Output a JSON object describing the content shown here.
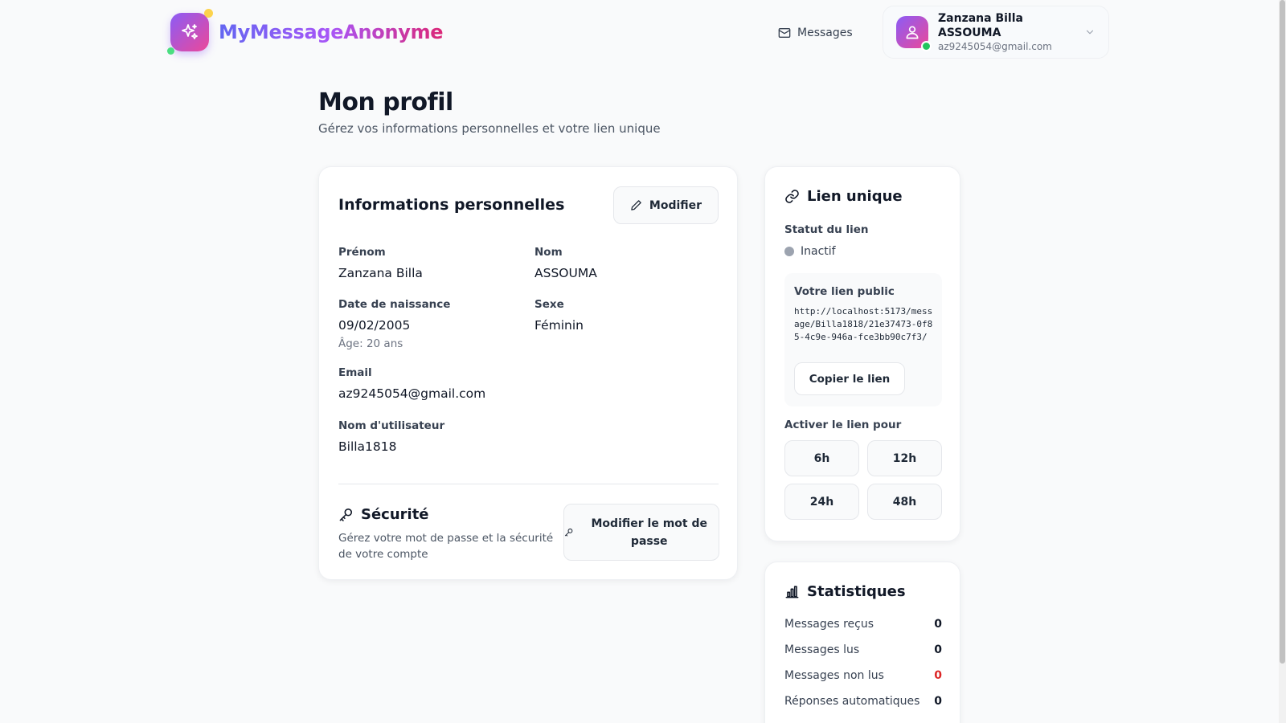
{
  "header": {
    "brand": "MyMessageAnonyme",
    "nav_messages": "Messages",
    "user": {
      "name": "Zanzana Billa ASSOUMA",
      "email": "az9245054@gmail.com"
    }
  },
  "page": {
    "title": "Mon profil",
    "subtitle": "Gérez vos informations personnelles et votre lien unique"
  },
  "personal_info": {
    "title": "Informations personnelles",
    "edit_button": "Modifier",
    "fields": {
      "first_name": {
        "label": "Prénom",
        "value": "Zanzana Billa"
      },
      "last_name": {
        "label": "Nom",
        "value": "ASSOUMA"
      },
      "birth_date": {
        "label": "Date de naissance",
        "value": "09/02/2005",
        "hint": "Âge: 20 ans"
      },
      "gender": {
        "label": "Sexe",
        "value": "Féminin"
      },
      "email": {
        "label": "Email",
        "value": "az9245054@gmail.com"
      },
      "username": {
        "label": "Nom d'utilisateur",
        "value": "Billa1818"
      }
    },
    "security": {
      "title": "Sécurité",
      "description": "Gérez votre mot de passe et la sécurité de votre compte",
      "button": "Modifier le mot de passe"
    }
  },
  "unique_link": {
    "title": "Lien unique",
    "status_label": "Statut du lien",
    "status": "Inactif",
    "public_link_label": "Votre lien public",
    "url": "http://localhost:5173/message/Billa1818/21e37473-0f85-4c9e-946a-fce3bb90c7f3/",
    "copy_button": "Copier le lien",
    "activate_label": "Activer le lien pour",
    "durations": [
      "6h",
      "12h",
      "24h",
      "48h"
    ]
  },
  "statistics": {
    "title": "Statistiques",
    "rows": [
      {
        "label": "Messages reçus",
        "value": "0"
      },
      {
        "label": "Messages lus",
        "value": "0"
      },
      {
        "label": "Messages non lus",
        "value": "0"
      },
      {
        "label": "Réponses automatiques",
        "value": "0"
      }
    ]
  },
  "colors": {
    "accent_start": "#8b5cf6",
    "accent_end": "#ec4899",
    "online": "#22c55e",
    "unread": "#dc2626",
    "inactive": "#9ca3af"
  }
}
